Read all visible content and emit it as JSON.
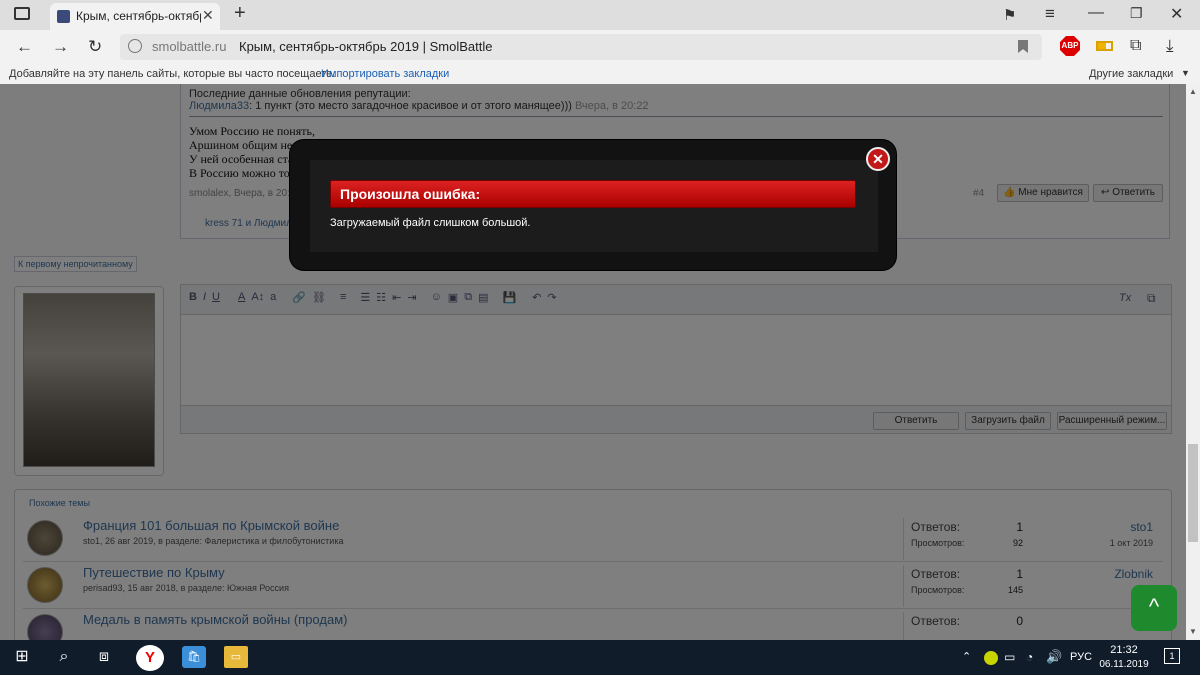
{
  "browser": {
    "tab_title": "Крым, сентябрь-октябрь",
    "tab_close": "✕",
    "new_tab": "+",
    "domain": "smolbattle.ru",
    "page_title": "Крым, сентябрь-октябрь 2019 | SmolBattle",
    "adblock": "ABP",
    "bookmarks_hint": "Добавляйте на эту панель сайты, которые вы часто посещаете.",
    "import_bookmarks": "Импортировать закладки",
    "other_bookmarks": "Другие закладки"
  },
  "post": {
    "rep_title": "Последние данные обновления репутации:",
    "rep_user": "Людмила33",
    "rep_text": ": 1 пункт (это место загадочное красивое и от этого манящее)))",
    "rep_time": "Вчера, в 20:22",
    "poem": [
      "Умом Россию не понять,",
      "Аршином общим не измерить:",
      "У ней особенная стать —",
      "В Россию можно только верить."
    ],
    "meta": "smolalex, Вчера, в 20:",
    "likes_count": "#4",
    "like_btn": "Мне нравится",
    "reply_btn": "Ответить",
    "liked_by": "kress 71 и Людмила33 нравится это."
  },
  "first_unread": "К первому непрочитанному",
  "editor": {
    "toolbar": [
      "B",
      "I",
      "U",
      "A",
      "A↕",
      "a",
      "🔗",
      "⛓",
      "≡",
      "☰",
      "☷",
      "⇤",
      "⇥",
      "☺",
      "▣",
      "⧉",
      "▤",
      "💾",
      "↶",
      "↷"
    ],
    "clear_format": "Tx",
    "reply": "Ответить",
    "upload": "Загрузить файл",
    "advanced": "Расширенный режим..."
  },
  "similar": {
    "title": "Похожие темы",
    "threads": [
      {
        "title": "Франция 101 большая по Крымской войне",
        "sub": "sto1, 26 авг 2019, в разделе: Фалеристика и филобутонистика",
        "answers_label": "Ответов:",
        "answers": "1",
        "views_label": "Просмотров:",
        "views": "92",
        "last_user": "sto1",
        "last_date": "1 окт 2019"
      },
      {
        "title": "Путешествие по Крыму",
        "sub": "perisad93, 15 авг 2018, в разделе: Южная Россия",
        "answers_label": "Ответов:",
        "answers": "1",
        "views_label": "Просмотров:",
        "views": "145",
        "last_user": "Zlobnik",
        "last_date": "4 ию"
      },
      {
        "title": "Медаль в память крымской войны (продам)",
        "sub": "",
        "answers_label": "Ответов:",
        "answers": "0",
        "views_label": "",
        "views": "",
        "last_user": "Тим",
        "last_date": ""
      }
    ]
  },
  "modal": {
    "title": "Произошла ошибка:",
    "message": "Загружаемый файл слишком большой.",
    "close": "✕"
  },
  "gotop": "^",
  "taskbar": {
    "lang": "РУС",
    "time": "21:32",
    "date": "06.11.2019",
    "notif_count": "1"
  }
}
